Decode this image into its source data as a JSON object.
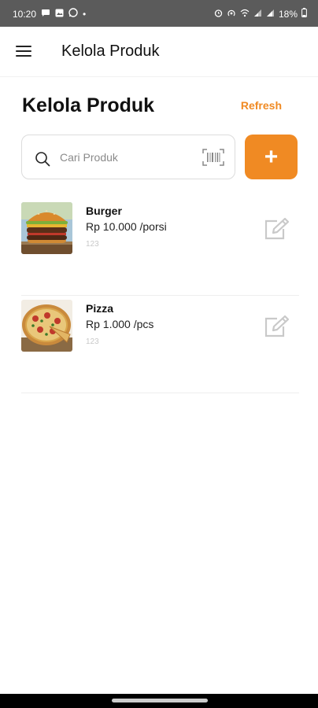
{
  "status_bar": {
    "time": "10:20",
    "battery": "18%",
    "dot": "•",
    "left_icons": [
      "chat-icon",
      "gallery-icon",
      "whatsapp-icon"
    ],
    "right_icons": [
      "alarm-icon",
      "hotspot-icon",
      "wifi-icon",
      "signal-icon",
      "signal-icon",
      "battery-icon"
    ]
  },
  "app_bar": {
    "title": "Kelola Produk",
    "menu_icon": "hamburger-menu-icon"
  },
  "page": {
    "title": "Kelola Produk",
    "refresh_label": "Refresh"
  },
  "search": {
    "placeholder": "Cari Produk",
    "value": ""
  },
  "add_button": {
    "label": "+"
  },
  "products": [
    {
      "name": "Burger",
      "price": "Rp 10.000 /porsi",
      "code": "123",
      "image": "burger-photo"
    },
    {
      "name": "Pizza",
      "price": "Rp 1.000 /pcs",
      "code": "123",
      "image": "pizza-photo"
    }
  ],
  "colors": {
    "accent": "#f08a23",
    "status_bar": "#5b5b5b",
    "muted_text": "#c8c8c8"
  }
}
